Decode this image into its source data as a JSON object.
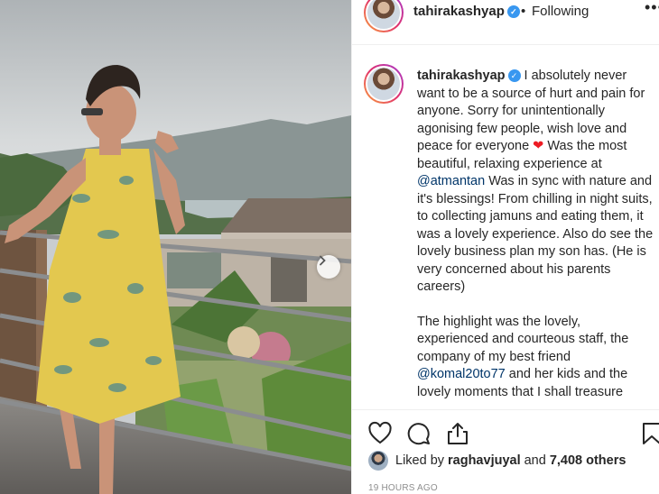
{
  "post": {
    "username": "tahirakashyap",
    "follow_dot": "•",
    "follow_status": "Following",
    "more_icon": "•••"
  },
  "caption": {
    "username": "tahirakashyap",
    "part1": " I absolutely never want to be a source of hurt and pain for anyone. Sorry for unintentionally agonising few people, wish love and peace for everyone ",
    "heart": "❤",
    "part2": " Was the most beautiful, relaxing experience at ",
    "mention1": "@atmantan",
    "part3": " Was in sync with nature and it's blessings! From chilling in night suits, to collecting jamuns and eating them, it was a lovely experience. Also do see the lovely business plan my son has. (He is very concerned about his parents careers)",
    "para2_part1": "The highlight was the lovely, experienced and courteous staff, the company of my best friend ",
    "mention2": "@komal20to77",
    "para2_part2": " and her kids and the lovely moments that I shall treasure"
  },
  "likes": {
    "prefix": "Liked by",
    "user": "raghavjuyal",
    "and": "and",
    "count": "7,408 others"
  },
  "timestamp": "19 HOURS AGO",
  "icons": {
    "verified": "✓",
    "carousel_next": "›"
  },
  "colors": {
    "verified_blue": "#3897f0",
    "mention_blue": "#003569",
    "heart_red": "#ed1c24",
    "muted": "#8e8e8e"
  }
}
